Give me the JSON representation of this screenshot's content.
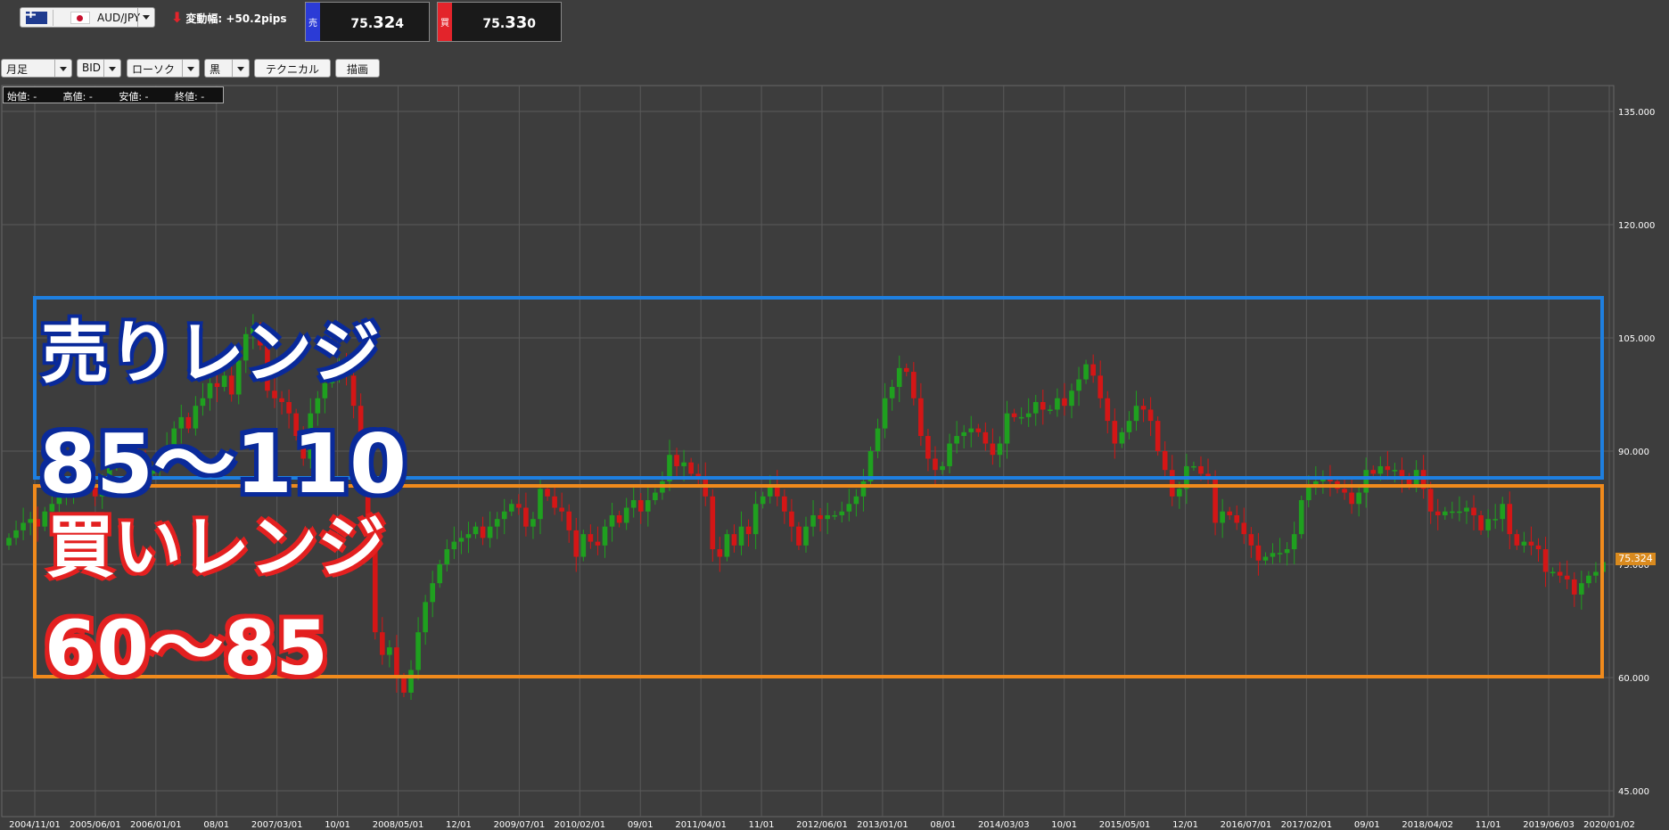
{
  "toolbar": {
    "pair": "AUD/JPY",
    "change_label": "変動幅:",
    "change_value": "+50.2pips",
    "sell": {
      "tag": "売",
      "price_prefix": "75.",
      "price_big": "32",
      "price_last": "4"
    },
    "buy": {
      "tag": "買",
      "price_prefix": "75.",
      "price_big": "33",
      "price_last": "0"
    },
    "timeframe": "月足",
    "price_type": "BID",
    "chart_type": "ローソク",
    "theme": "黒",
    "technical_button": "テクニカル",
    "draw_button": "描画"
  },
  "ohlc": {
    "open": "始値: -",
    "high": "高値: -",
    "low": "安値: -",
    "close": "終値: -"
  },
  "last_price_tag": "75.324",
  "annotations": {
    "sell_title": "売りレンジ",
    "sell_range": "85～110",
    "buy_title": "買いレンジ",
    "buy_range": "60～85"
  },
  "colors": {
    "background": "#3d3d3d",
    "grid": "#5a5a5a",
    "up": "#1fa01f",
    "down": "#d41616",
    "sell_box": "#1e7fe0",
    "buy_box": "#f08a1c"
  },
  "chart_data": {
    "type": "candlestick",
    "ylim": [
      40,
      140
    ],
    "yticks": [
      45,
      60,
      75,
      90,
      105,
      120,
      135
    ],
    "ytick_labels": [
      "45.000",
      "60.000",
      "75.000",
      "90.000",
      "105.000",
      "120.000",
      "135.000"
    ],
    "xtick_labels": [
      "2004/11/01",
      "2005/06/01",
      "2006/01/01",
      "08/01",
      "2007/03/01",
      "10/01",
      "2008/05/01",
      "12/01",
      "2009/07/01",
      "2010/02/01",
      "09/01",
      "2011/04/01",
      "11/01",
      "2012/06/01",
      "2013/01/01",
      "08/01",
      "2014/03/03",
      "10/01",
      "2015/05/01",
      "12/01",
      "2016/07/01",
      "2017/02/01",
      "09/01",
      "2018/04/02",
      "11/01",
      "2019/06/03",
      "2020/01/02"
    ],
    "closes": [
      78.5,
      79.5,
      80.5,
      81,
      80,
      82,
      83,
      84.5,
      85,
      86,
      87.5,
      85.5,
      84,
      86,
      88,
      89.5,
      89,
      90,
      88.5,
      87,
      87.5,
      88.5,
      90.5,
      93,
      94.5,
      93,
      96,
      97,
      99,
      98.5,
      100,
      97.5,
      102,
      105.5,
      106.5,
      104,
      98,
      97,
      96.5,
      95,
      92,
      89,
      95,
      97,
      99,
      100,
      101,
      100,
      96,
      88,
      79,
      66,
      63,
      64,
      60,
      58,
      61,
      66,
      70,
      72.5,
      75,
      77,
      78,
      78.5,
      79,
      80,
      78.5,
      80,
      81,
      82,
      83,
      82.5,
      80,
      81,
      85,
      84,
      82.5,
      82,
      79.5,
      76,
      79,
      78,
      77.5,
      80,
      81.5,
      80.5,
      82.5,
      83.5,
      82,
      83.5,
      84.5,
      86,
      89.5,
      88,
      88.5,
      87,
      86.5,
      84,
      77,
      76,
      79,
      77.5,
      80,
      79,
      83,
      84,
      85.5,
      84,
      82,
      80,
      77.5,
      80,
      81.5,
      81,
      81.5,
      81.5,
      82,
      83,
      84,
      86,
      90,
      93,
      97,
      98.5,
      101,
      100.5,
      97,
      92,
      89,
      87.5,
      88,
      91,
      92,
      92.5,
      93,
      92.5,
      91,
      89.5,
      91,
      95,
      94.5,
      94.5,
      95,
      96.5,
      95.5,
      95.5,
      97,
      96,
      98,
      99.5,
      101.5,
      100,
      97,
      94,
      91,
      92.5,
      94,
      96,
      95.5,
      94,
      90,
      87.5,
      84,
      85,
      88,
      88,
      87,
      86.5,
      80.5,
      82,
      81.5,
      80.5,
      79,
      77.5,
      75.5,
      76,
      76.5,
      76.5,
      77,
      79,
      83.5,
      85.5,
      86,
      86.5,
      86,
      85,
      84.5,
      83,
      84.5,
      87.5,
      87,
      88,
      87.5,
      87.5,
      86.5,
      85.5,
      87.5,
      85,
      82,
      81.5,
      82,
      82,
      82,
      82.5,
      81.5,
      79.5,
      81,
      81,
      83,
      79,
      77.5,
      78,
      77.5,
      77,
      74,
      74,
      73.5,
      73,
      71,
      72.5,
      73.5,
      74,
      75.3
    ]
  }
}
